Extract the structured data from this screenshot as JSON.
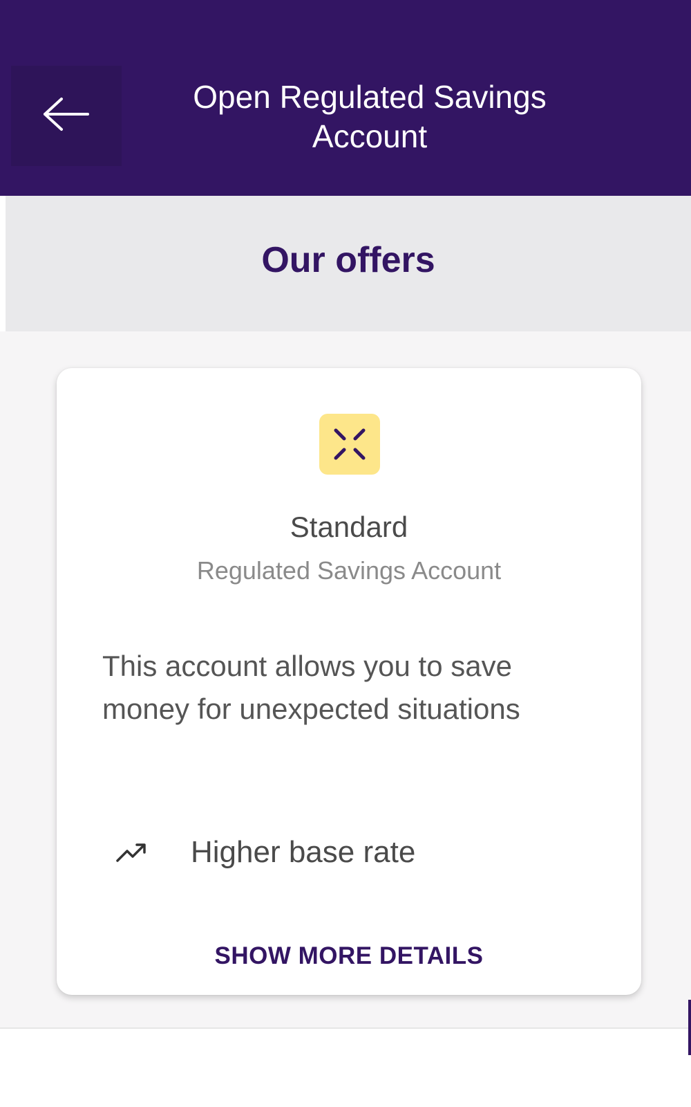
{
  "header": {
    "back_icon": "arrow-left-icon",
    "title": "Open Regulated Savings Account"
  },
  "section": {
    "title": "Our offers"
  },
  "offer_card": {
    "icon": "compress-arrows-icon",
    "name": "Standard",
    "subtitle": "Regulated Savings Account",
    "description": "This account allows you to save money for unexpected situations",
    "features": [
      {
        "icon": "trending-up-icon",
        "label": "Higher base rate"
      }
    ],
    "details_link": "SHOW MORE DETAILS"
  },
  "colors": {
    "brand": "#331563",
    "icon_background": "#fde68a",
    "section_background": "#e9e9eb"
  }
}
